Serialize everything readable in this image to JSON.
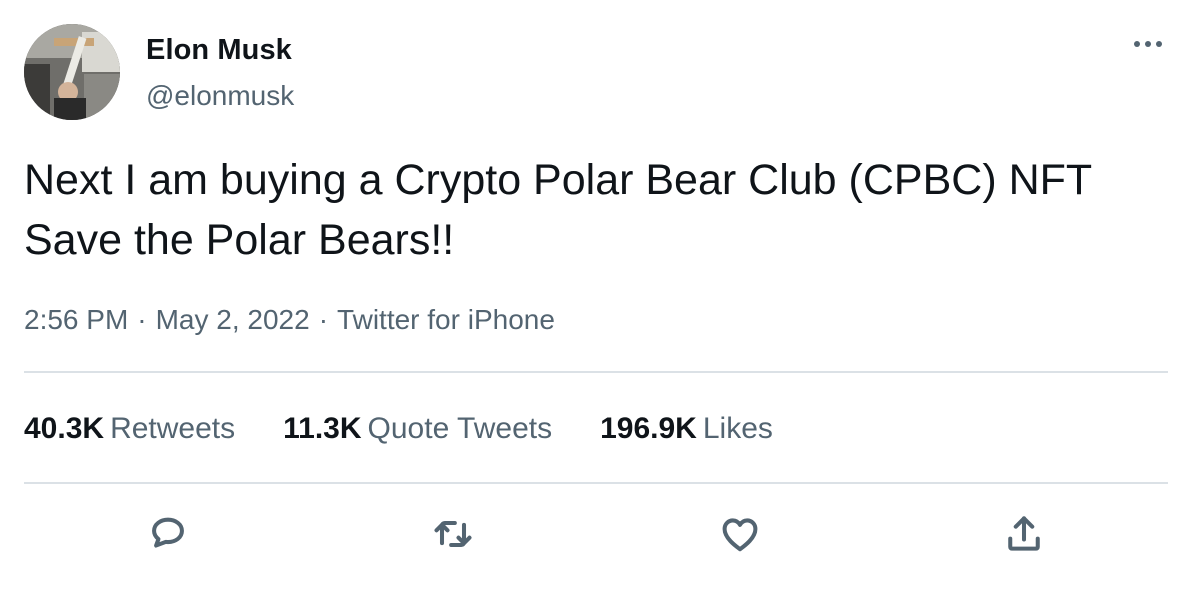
{
  "author": {
    "name": "Elon Musk",
    "handle": "@elonmusk"
  },
  "tweet": {
    "lines": [
      "Next I am buying a Crypto Polar Bear Club (CPBC) NFT",
      "Save the Polar Bears!!"
    ]
  },
  "meta": {
    "time": "2:56 PM",
    "separator": "·",
    "date": "May 2, 2022",
    "source": "Twitter for iPhone"
  },
  "stats": {
    "retweets": {
      "count": "40.3K",
      "label": "Retweets"
    },
    "quotes": {
      "count": "11.3K",
      "label": "Quote Tweets"
    },
    "likes": {
      "count": "196.9K",
      "label": "Likes"
    }
  },
  "icons": {
    "more": "more-horizontal-icon",
    "reply": "reply-icon",
    "retweet": "retweet-icon",
    "like": "heart-icon",
    "share": "share-icon"
  },
  "colors": {
    "text": "#0f1419",
    "secondary": "#536471",
    "divider": "#dbe1e6"
  }
}
